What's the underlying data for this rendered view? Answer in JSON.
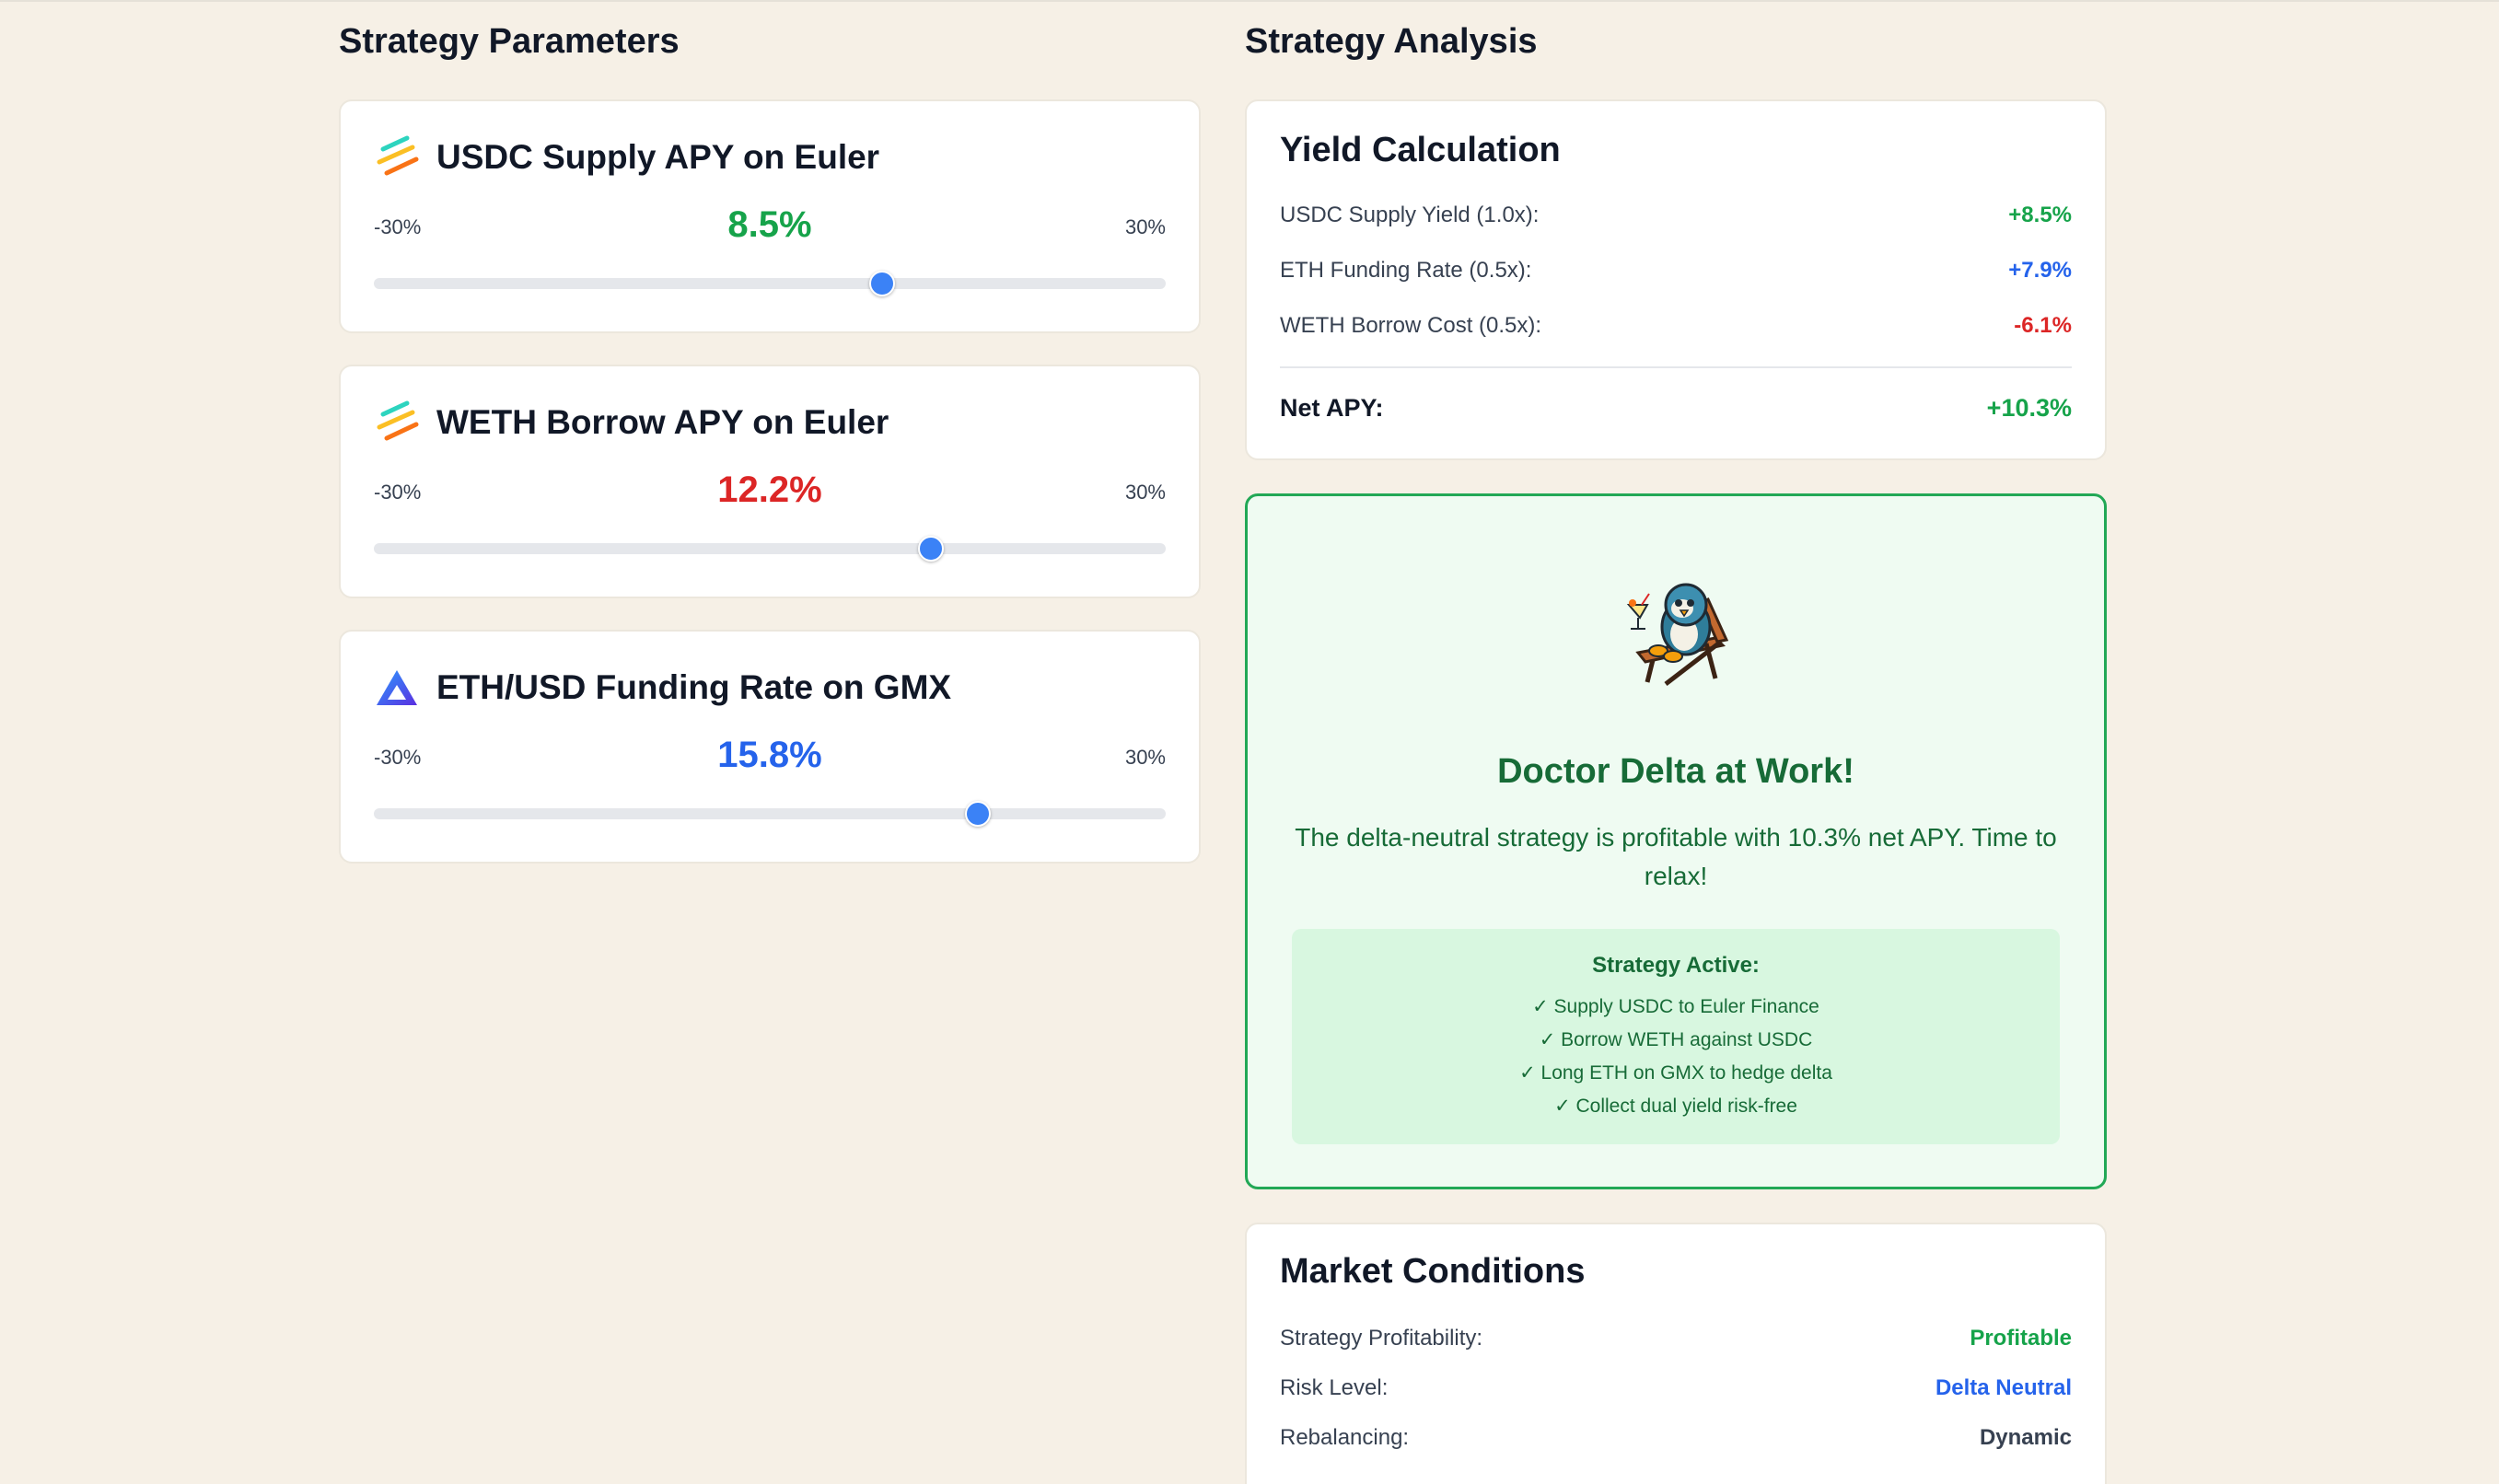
{
  "left": {
    "section_title": "Strategy Parameters",
    "sliders": [
      {
        "title": "USDC Supply APY on Euler",
        "min_label": "-30%",
        "max_label": "30%",
        "value_label": "8.5%",
        "value": 8.5,
        "min": -30,
        "max": 30,
        "value_color": "#16a34a",
        "logo": "euler-logo"
      },
      {
        "title": "WETH Borrow APY on Euler",
        "min_label": "-30%",
        "max_label": "30%",
        "value_label": "12.2%",
        "value": 12.2,
        "min": -30,
        "max": 30,
        "value_color": "#dc2626",
        "logo": "euler-logo"
      },
      {
        "title": "ETH/USD Funding Rate on GMX",
        "min_label": "-30%",
        "max_label": "30%",
        "value_label": "15.8%",
        "value": 15.8,
        "min": -30,
        "max": 30,
        "value_color": "#2563eb",
        "logo": "gmx-logo"
      }
    ]
  },
  "right": {
    "section_title": "Strategy Analysis",
    "yield": {
      "title": "Yield Calculation",
      "rows": [
        {
          "label": "USDC Supply Yield (1.0x):",
          "value": "+8.5%",
          "color": "#16a34a"
        },
        {
          "label": "ETH Funding Rate (0.5x):",
          "value": "+7.9%",
          "color": "#2563eb"
        },
        {
          "label": "WETH Borrow Cost (0.5x):",
          "value": "-6.1%",
          "color": "#dc2626"
        }
      ],
      "net_label": "Net APY:",
      "net_value": "+10.3%",
      "net_color": "#16a34a"
    },
    "doctor": {
      "icon": "penguin-lounging-icon",
      "title": "Doctor Delta at Work!",
      "message": "The delta-neutral strategy is profitable with 10.3% net APY. Time to relax!",
      "active_title": "Strategy Active:",
      "active_items": [
        "✓ Supply USDC to Euler Finance",
        "✓ Borrow WETH against USDC",
        "✓ Long ETH on GMX to hedge delta",
        "✓ Collect dual yield risk-free"
      ]
    },
    "market": {
      "title": "Market Conditions",
      "rows": [
        {
          "label": "Strategy Profitability:",
          "value": "Profitable",
          "color": "#16a34a"
        },
        {
          "label": "Risk Level:",
          "value": "Delta Neutral",
          "color": "#2563eb"
        },
        {
          "label": "Rebalancing:",
          "value": "Dynamic",
          "color": "#374151"
        }
      ]
    }
  }
}
